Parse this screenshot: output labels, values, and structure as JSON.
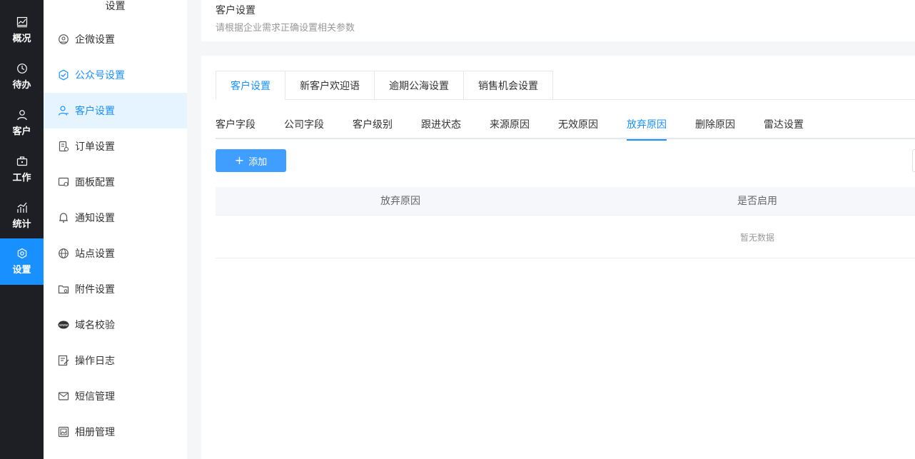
{
  "rail": {
    "items": [
      {
        "label": "概况",
        "icon": "chart-line-icon"
      },
      {
        "label": "待办",
        "icon": "clock-icon"
      },
      {
        "label": "客户",
        "icon": "user-icon"
      },
      {
        "label": "工作",
        "icon": "briefcase-icon"
      },
      {
        "label": "统计",
        "icon": "bar-chart-icon"
      },
      {
        "label": "设置",
        "icon": "gear-icon"
      }
    ],
    "active_color": "#1890ff"
  },
  "sidebar": {
    "title": "设置",
    "items": [
      {
        "label": "企微设置",
        "icon": "wecom-icon"
      },
      {
        "label": "公众号设置",
        "icon": "check-badge-icon"
      },
      {
        "label": "客户设置",
        "icon": "users-icon"
      },
      {
        "label": "订单设置",
        "icon": "order-icon"
      },
      {
        "label": "面板配置",
        "icon": "panel-icon"
      },
      {
        "label": "通知设置",
        "icon": "bell-icon"
      },
      {
        "label": "站点设置",
        "icon": "globe-icon"
      },
      {
        "label": "附件设置",
        "icon": "folder-icon"
      },
      {
        "label": "域名校验",
        "icon": "www-icon"
      },
      {
        "label": "操作日志",
        "icon": "edit-log-icon"
      },
      {
        "label": "短信管理",
        "icon": "mail-icon"
      },
      {
        "label": "相册管理",
        "icon": "image-icon"
      }
    ]
  },
  "header": {
    "title": "客户设置",
    "subtitle": "请根据企业需求正确设置相关参数"
  },
  "tabs": [
    {
      "label": "客户设置"
    },
    {
      "label": "新客户欢迎语"
    },
    {
      "label": "逾期公海设置"
    },
    {
      "label": "销售机会设置"
    }
  ],
  "subtabs": [
    {
      "label": "客户字段"
    },
    {
      "label": "公司字段"
    },
    {
      "label": "客户级别"
    },
    {
      "label": "跟进状态"
    },
    {
      "label": "来源原因"
    },
    {
      "label": "无效原因"
    },
    {
      "label": "放弃原因"
    },
    {
      "label": "删除原因"
    },
    {
      "label": "雷达设置"
    }
  ],
  "toolbar": {
    "add_label": "添加"
  },
  "table": {
    "columns": [
      "放弃原因",
      "是否启用"
    ],
    "empty_text": "暂无数据"
  }
}
